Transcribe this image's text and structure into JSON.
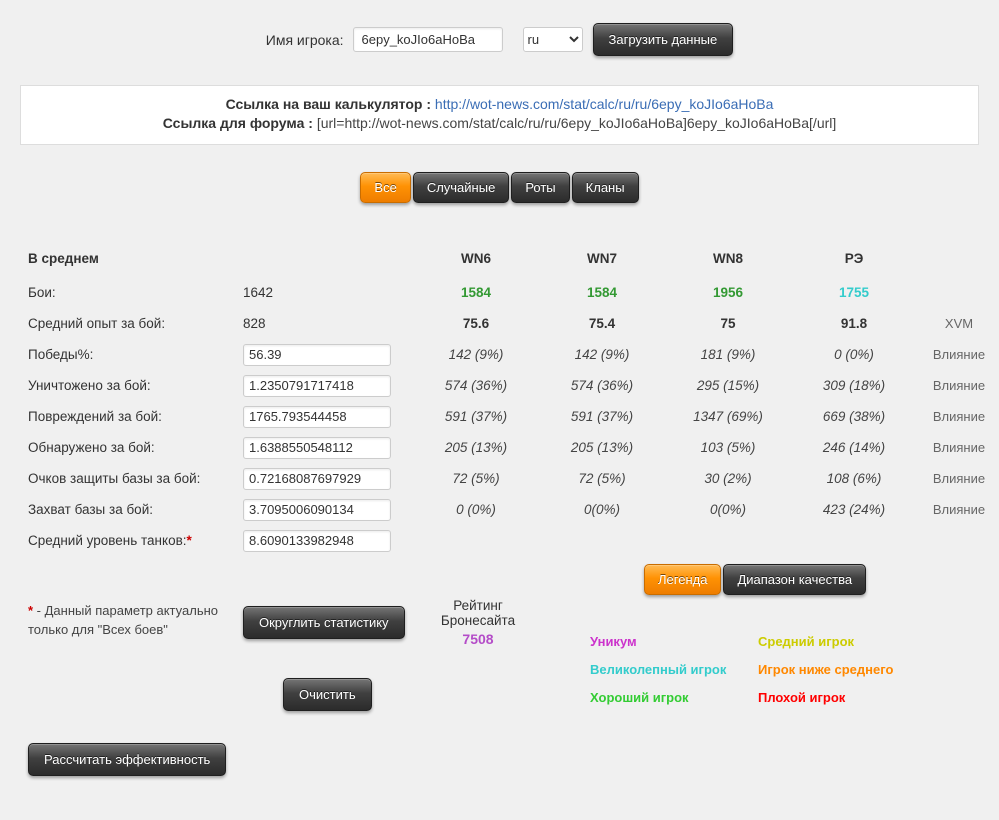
{
  "top_form": {
    "player_label": "Имя игрока:",
    "player_name": "6epy_koJIo6aHoBa",
    "server": "ru",
    "load_button": "Загрузить данные"
  },
  "links": {
    "calc_label": "Ссылка на ваш калькулятор",
    "colon": ":",
    "calc_url": "http://wot-news.com/stat/calc/ru/ru/6epy_koJIo6aHoBa",
    "forum_label": "Ссылка для форума",
    "forum_code": "[url=http://wot-news.com/stat/calc/ru/ru/6epy_koJIo6aHoBa]6epy_koJIo6aHoBa[/url]"
  },
  "tabs": {
    "all": "Все",
    "random": "Случайные",
    "companies": "Роты",
    "clans": "Кланы"
  },
  "stats": {
    "section_title": "В среднем",
    "col_wn6": "WN6",
    "col_wn7": "WN7",
    "col_wn8": "WN8",
    "col_re": "РЭ",
    "rows": [
      {
        "label": "Бои:",
        "value": "1642",
        "wn6": "1584",
        "wn7": "1584",
        "wn8": "1956",
        "re": "1755",
        "extra": ""
      },
      {
        "label": "Средний опыт за бой:",
        "value": "828",
        "wn6": "75.6",
        "wn7": "75.4",
        "wn8": "75",
        "re": "91.8",
        "extra": "XVM"
      },
      {
        "label": "Победы%:",
        "value": "56.39",
        "wn6": "142 (9%)",
        "wn7": "142 (9%)",
        "wn8": "181 (9%)",
        "re": "0 (0%)",
        "extra": "Влияние"
      },
      {
        "label": "Уничтожено за бой:",
        "value": "1.2350791717418",
        "wn6": "574 (36%)",
        "wn7": "574 (36%)",
        "wn8": "295 (15%)",
        "re": "309 (18%)",
        "extra": "Влияние"
      },
      {
        "label": "Повреждений за бой:",
        "value": "1765.793544458",
        "wn6": "591 (37%)",
        "wn7": "591 (37%)",
        "wn8": "1347 (69%)",
        "re": "669 (38%)",
        "extra": "Влияние"
      },
      {
        "label": "Обнаружено за бой:",
        "value": "1.6388550548112",
        "wn6": "205 (13%)",
        "wn7": "205 (13%)",
        "wn8": "103 (5%)",
        "re": "246 (14%)",
        "extra": "Влияние"
      },
      {
        "label": "Очков защиты базы за бой:",
        "value": "0.72168087697929",
        "wn6": "72 (5%)",
        "wn7": "72 (5%)",
        "wn8": "30 (2%)",
        "re": "108 (6%)",
        "extra": "Влияние"
      },
      {
        "label": "Захват базы за бой:",
        "value": "3.7095006090134",
        "wn6": "0 (0%)",
        "wn7": "0(0%)",
        "wn8": "0(0%)",
        "re": "423 (24%)",
        "extra": "Влияние"
      },
      {
        "label": "Средний уровень танков:",
        "asterisk": "*",
        "value": "8.6090133982948"
      }
    ]
  },
  "legend": {
    "tab_legend": "Легенда",
    "tab_range": "Диапазон качества",
    "entries": [
      {
        "label": "Уникум",
        "color": "#cc33cc"
      },
      {
        "label": "Средний игрок",
        "color": "#cccc00"
      },
      {
        "label": "Великолепный игрок",
        "color": "#33cccc"
      },
      {
        "label": "Игрок ниже среднего",
        "color": "#ff8800"
      },
      {
        "label": "Хороший игрок",
        "color": "#33cc33"
      },
      {
        "label": "Плохой игрок",
        "color": "#ff0000"
      }
    ]
  },
  "bottom": {
    "note_star": "*",
    "note_text": " - Данный параметр актуально только для \"Всех боев\"",
    "round_button": "Округлить статистику",
    "rating_line1": "Рейтинг",
    "rating_line2": "Бронесайта",
    "rating_value": "7508",
    "clear_button": "Очистить",
    "calc_button": "Рассчитать эффективность"
  }
}
